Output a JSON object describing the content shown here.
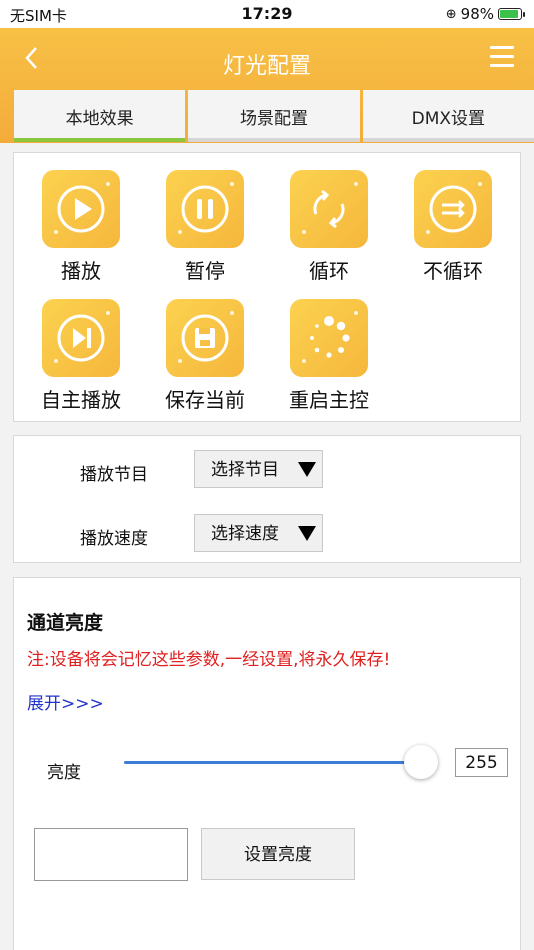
{
  "status": {
    "carrier": "无SIM卡",
    "time": "17:29",
    "battery_pct": "98%"
  },
  "nav": {
    "title": "灯光配置"
  },
  "tabs": [
    {
      "label": "本地效果",
      "active": true
    },
    {
      "label": "场景配置",
      "active": false
    },
    {
      "label": "DMX设置",
      "active": false
    }
  ],
  "actions": [
    {
      "label": "播放",
      "icon": "play-icon"
    },
    {
      "label": "暂停",
      "icon": "pause-icon"
    },
    {
      "label": "循环",
      "icon": "loop-icon"
    },
    {
      "label": "不循环",
      "icon": "no-loop-icon"
    },
    {
      "label": "自主播放",
      "icon": "next-play-icon"
    },
    {
      "label": "保存当前",
      "icon": "save-icon"
    },
    {
      "label": "重启主控",
      "icon": "restart-icon"
    }
  ],
  "program": {
    "label": "播放节目",
    "select": "选择节目"
  },
  "speed": {
    "label": "播放速度",
    "select": "选择速度"
  },
  "brightness": {
    "title": "通道亮度",
    "note": "注:设备将会记忆这些参数,一经设置,将永久保存!",
    "expand": "展开>>>",
    "label": "亮度",
    "value": "255",
    "level_fraction": 1.0,
    "input_value": "",
    "set_button": "设置亮度"
  },
  "colors": {
    "accent": "#f5b73c",
    "tab_active": "#8cc63e",
    "slider": "#3d7bd9",
    "note": "#e02020",
    "link": "#2233cc"
  }
}
